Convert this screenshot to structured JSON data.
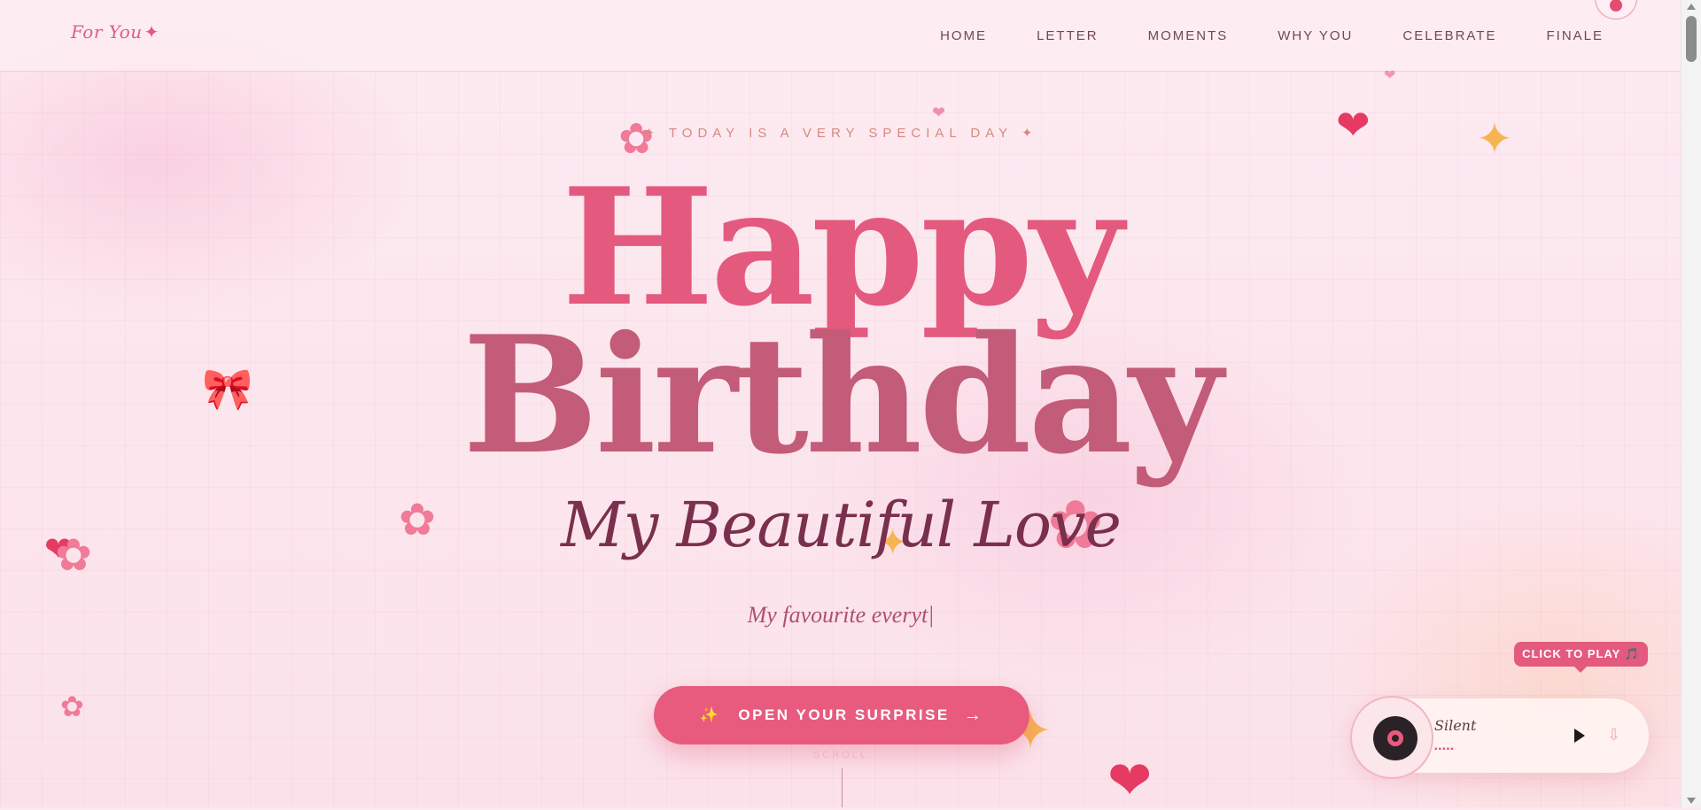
{
  "nav": {
    "logo": "For You",
    "logo_glyph": "✦",
    "links": [
      "HOME",
      "LETTER",
      "MOMENTS",
      "WHY YOU",
      "CELEBRATE",
      "FINALE"
    ]
  },
  "hero": {
    "eyebrow": "✦  TODAY IS A VERY SPECIAL DAY  ✦",
    "title_line1": "Happy",
    "title_line2": "Birthday",
    "subtitle": "My Beautiful Love",
    "tagline": "My favourite everyt|",
    "cta_icon": "✨",
    "cta_label": "OPEN YOUR SURPRISE",
    "cta_arrow": "→",
    "scroll_hint": "SCROLL"
  },
  "player": {
    "tooltip": "CLICK TO PLAY 🎵",
    "track": "Silent",
    "bars": "▪▪▪▪▪",
    "play_icon": "play-icon",
    "download_icon": "download-icon"
  },
  "colors": {
    "accent": "#e85b7f",
    "title_happy": "#e45a7f",
    "title_birthday": "#c25c78",
    "subtitle": "#7a2f4c",
    "background": "#fde8ef"
  }
}
